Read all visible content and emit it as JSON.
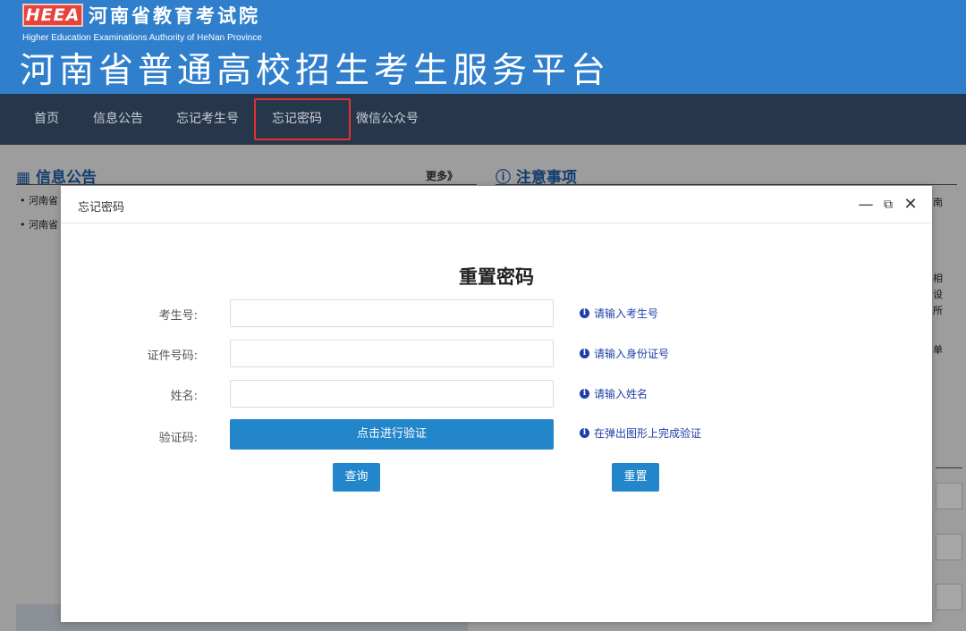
{
  "header": {
    "logo_mark": "HEEA",
    "logo_cn": "河南省教育考试院",
    "logo_en": "Higher Education Examinations Authority of HeNan Province",
    "site_title": "河南省普通高校招生考生服务平台"
  },
  "nav": {
    "items": [
      {
        "label": "首页"
      },
      {
        "label": "信息公告"
      },
      {
        "label": "忘记考生号"
      },
      {
        "label": "忘记密码"
      },
      {
        "label": "微信公众号"
      }
    ],
    "active_index": 3
  },
  "background": {
    "notices_title": "信息公告",
    "more_label": "更多》",
    "attention_title": "注意事项",
    "news_items": [
      "河南省",
      "河南省"
    ],
    "side_chars": [
      "南",
      "相",
      "设",
      "所",
      "单"
    ]
  },
  "modal": {
    "title": "忘记密码",
    "heading": "重置密码",
    "fields": [
      {
        "label": "考生号:",
        "value": "",
        "placeholder": "",
        "hint": "请输入考生号"
      },
      {
        "label": "证件号码:",
        "value": "",
        "placeholder": "",
        "hint": "请输入身份证号"
      },
      {
        "label": "姓名:",
        "value": "",
        "placeholder": "",
        "hint": "请输入姓名"
      }
    ],
    "captcha": {
      "label": "验证码:",
      "button_label": "点击进行验证",
      "hint": "在弹出图形上完成验证"
    },
    "query_label": "查询",
    "reset_label": "重置"
  },
  "colors": {
    "header_bg": "#2f7fcd",
    "nav_bg": "#27374b",
    "active_border": "#e23030",
    "primary_button": "#2386cb",
    "hint_text": "#1f3fa8"
  }
}
